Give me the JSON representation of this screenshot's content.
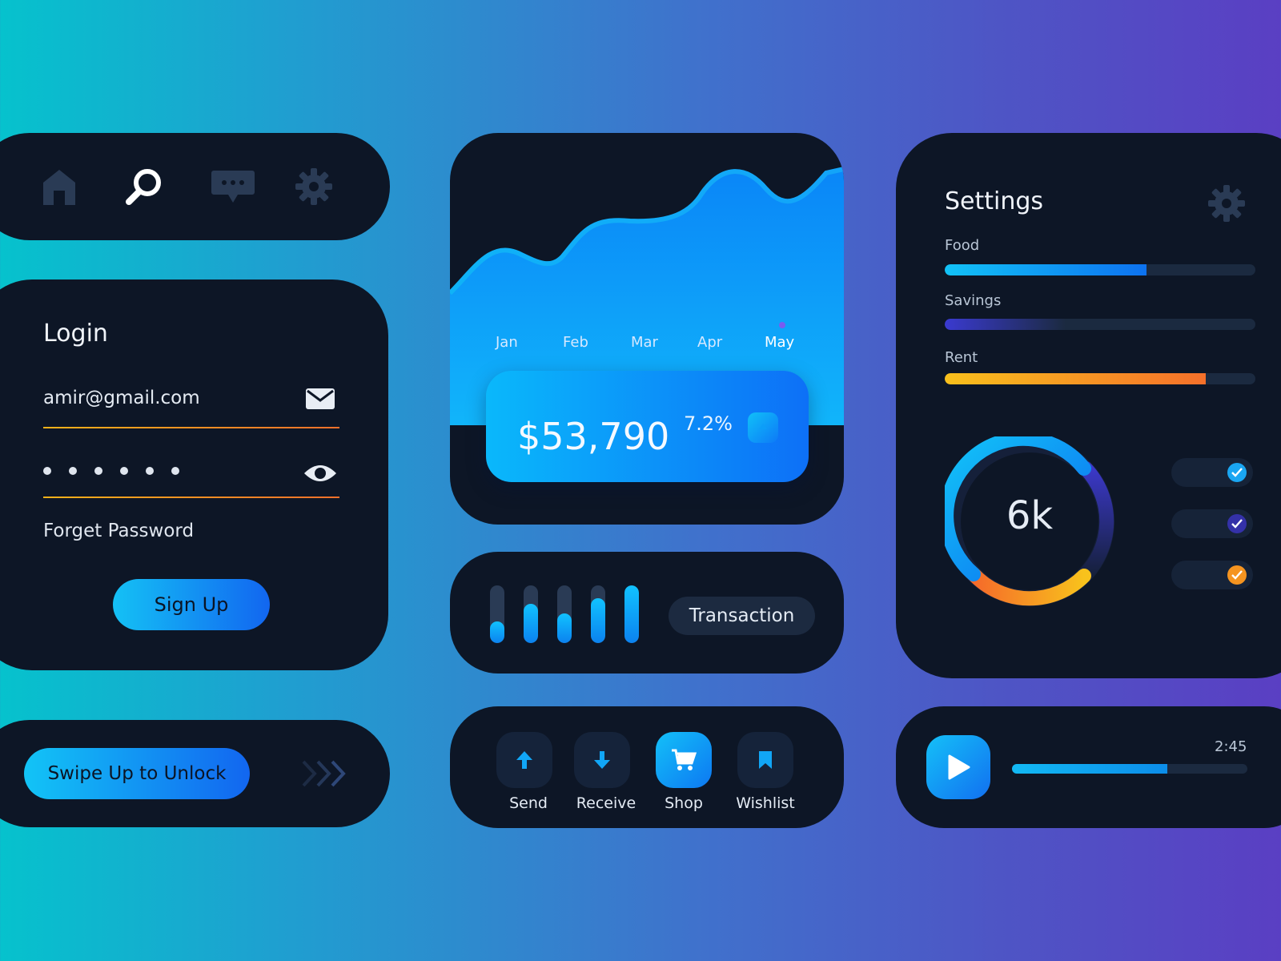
{
  "nav": {
    "items": [
      {
        "icon": "home-icon",
        "active": false
      },
      {
        "icon": "search-icon",
        "active": true
      },
      {
        "icon": "chat-icon",
        "active": false
      },
      {
        "icon": "gear-icon",
        "active": false
      }
    ]
  },
  "login": {
    "title": "Login",
    "email": "amir@gmail.com",
    "password_dots": 6,
    "forgot_label": "Forget Password",
    "signup_label": "Sign Up"
  },
  "unlock": {
    "label": "Swipe Up to Unlock"
  },
  "chart": {
    "months": [
      "Jan",
      "Feb",
      "Mar",
      "Apr",
      "May"
    ],
    "highlighted_month": "May",
    "amount": "$53,790",
    "change": "7.2%"
  },
  "transaction": {
    "label": "Transaction",
    "bar_levels": [
      0.38,
      0.68,
      0.52,
      0.78,
      1.0
    ]
  },
  "actions": {
    "items": [
      {
        "label": "Send",
        "icon": "arrow-up-icon",
        "active": false
      },
      {
        "label": "Receive",
        "icon": "arrow-down-icon",
        "active": false
      },
      {
        "label": "Shop",
        "icon": "cart-icon",
        "active": true
      },
      {
        "label": "Wishlist",
        "icon": "bookmark-icon",
        "active": false
      }
    ]
  },
  "settings": {
    "title": "Settings",
    "budgets": [
      {
        "label": "Food",
        "level": 0.65
      },
      {
        "label": "Savings",
        "level": 0.39
      },
      {
        "label": "Rent",
        "level": 0.84
      }
    ],
    "ring_value": "6k",
    "toggles": [
      {
        "on": true,
        "color": "#1aa6f2"
      },
      {
        "on": true,
        "color": "#3431a8"
      },
      {
        "on": true,
        "color": "#f59420"
      }
    ]
  },
  "player": {
    "time": "2:45",
    "progress": 0.66
  },
  "colors": {
    "card": "#0d1626",
    "accent_blue": "#0d7af7",
    "accent_cyan": "#11c2ff",
    "accent_orange": "#f3702b",
    "accent_yellow": "#f7b21a"
  }
}
